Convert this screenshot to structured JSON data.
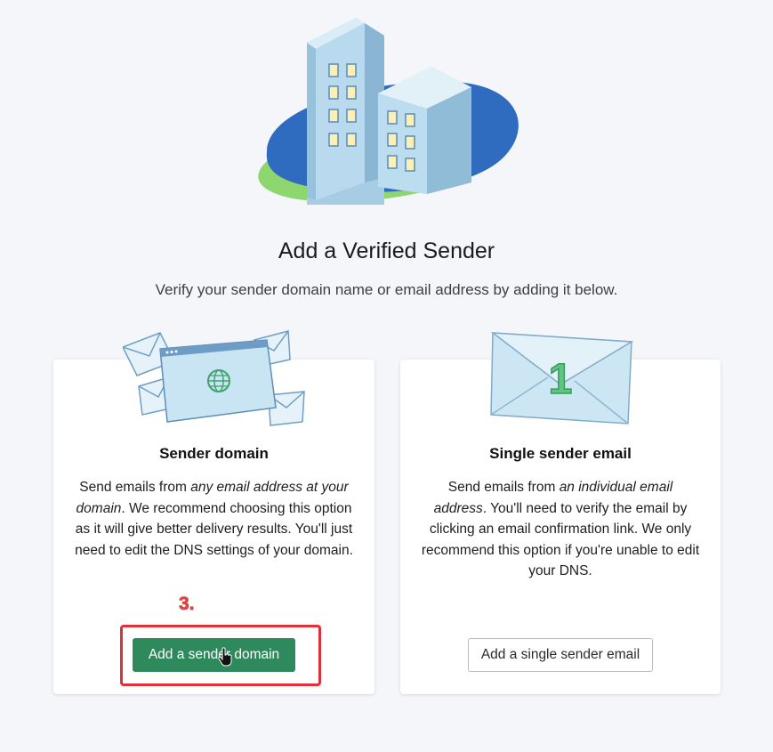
{
  "header": {
    "title": "Add a Verified Sender",
    "subtitle": "Verify your sender domain name or email address by adding it below."
  },
  "cards": [
    {
      "heading": "Sender domain",
      "description_parts": [
        "Send emails from ",
        "any email address at your domain",
        ". We recommend choosing this option as it will give better delivery results. You'll just need to edit the DNS settings of your domain."
      ],
      "button_label": "Add a sender domain",
      "illustration": "browser-window-with-envelopes"
    },
    {
      "heading": "Single sender email",
      "description_parts": [
        "Send emails from ",
        "an individual email address",
        ". You'll need to verify the email by clicking an email confirmation link. We only recommend this option if you're unable to edit your DNS."
      ],
      "button_label": "Add a single sender email",
      "illustration": "envelope-with-number-one",
      "illustration_number": "1"
    }
  ],
  "annotation": {
    "step_label": "3.",
    "highlight_color": "#e0303a"
  },
  "colors": {
    "primary_button": "#2e8a5c",
    "background": "#f5f6fa"
  }
}
